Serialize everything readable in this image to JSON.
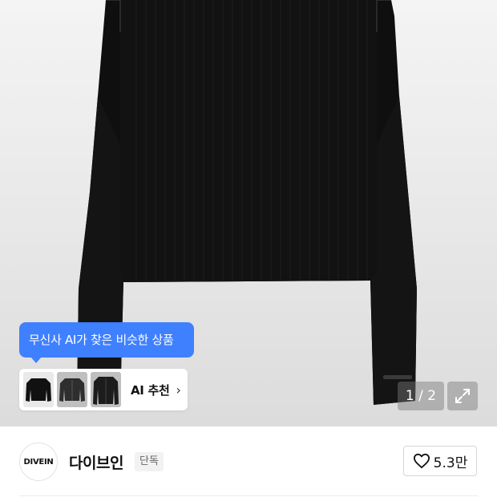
{
  "ai_tooltip": {
    "text": "무신사 AI가 찾은 비슷한 상품"
  },
  "ai_card": {
    "label": "AI 추천",
    "chevron": "›",
    "thumbnails": [
      "black-sweater-thumb",
      "charcoal-cardigan-thumb",
      "black-cardigan-thumb"
    ]
  },
  "pager": {
    "text": "1 / 2"
  },
  "expand": {
    "icon": "expand-icon"
  },
  "brand": {
    "logo_text": "DIVEIN",
    "name": "다이브인",
    "badge": "단독"
  },
  "like": {
    "icon": "heart-icon",
    "count": "5.3만"
  },
  "colors": {
    "accent": "#3f80ff",
    "garment": "#101010",
    "background": "#e8e8e8"
  }
}
